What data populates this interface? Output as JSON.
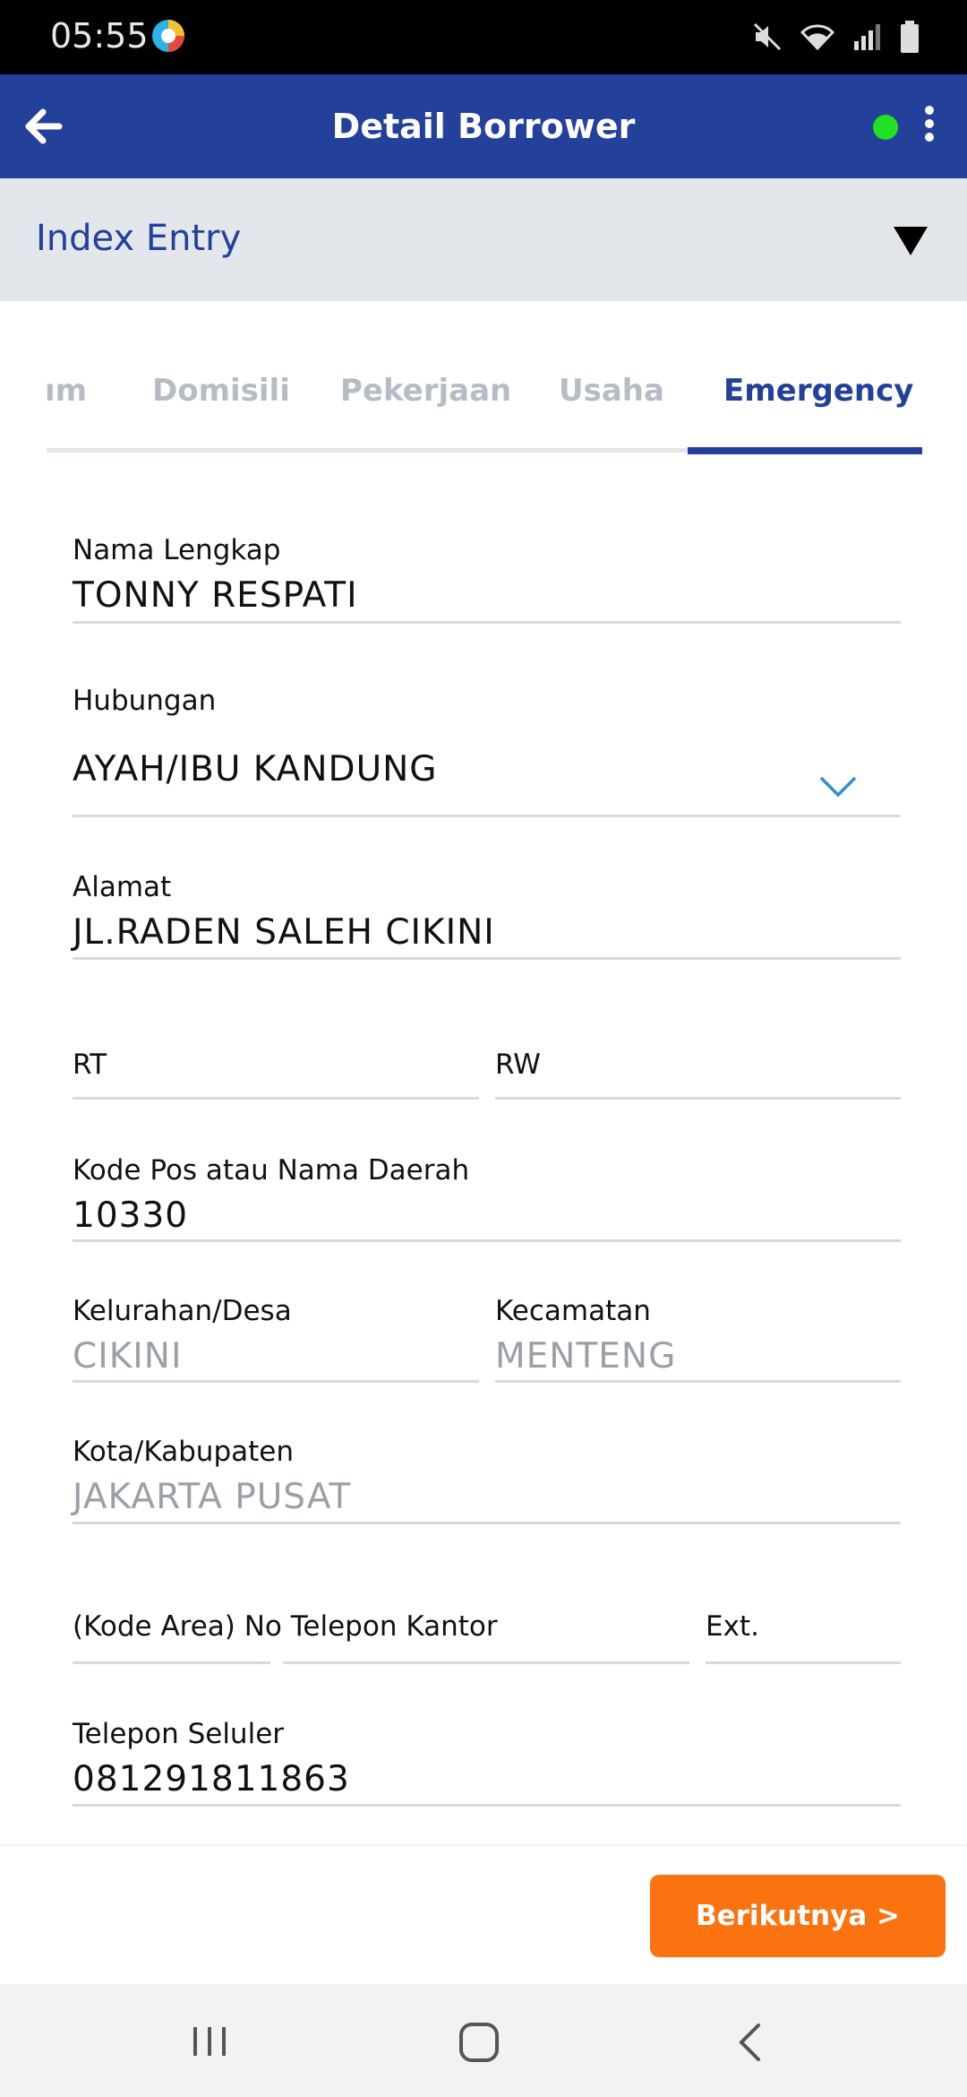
{
  "status_bar": {
    "time": "05:55",
    "icons": [
      "app-icon",
      "mute-icon",
      "wifi-icon",
      "signal-icon",
      "battery-icon"
    ]
  },
  "app_bar": {
    "title": "Detail Borrower",
    "back_icon": "arrow-left-icon",
    "status_dot_color": "#22e022",
    "menu_icon": "more-vertical-icon"
  },
  "index_entry": {
    "label": "Index Entry",
    "caret_icon": "triangle-down-icon"
  },
  "tabs": [
    {
      "label": "ım",
      "active": false
    },
    {
      "label": "Domisili",
      "active": false
    },
    {
      "label": "Pekerjaan",
      "active": false
    },
    {
      "label": "Usaha",
      "active": false
    },
    {
      "label": "Emergency",
      "active": true
    }
  ],
  "form": {
    "nama_lengkap": {
      "label": "Nama Lengkap",
      "value": "TONNY RESPATI"
    },
    "hubungan": {
      "label": "Hubungan",
      "value": "AYAH/IBU KANDUNG",
      "icon": "chevron-down-icon"
    },
    "alamat": {
      "label": "Alamat",
      "value": "JL.RADEN SALEH CIKINI"
    },
    "rt": {
      "label": "RT",
      "value": ""
    },
    "rw": {
      "label": "RW",
      "value": ""
    },
    "kode_pos": {
      "label": "Kode Pos atau Nama Daerah",
      "value": "10330"
    },
    "kelurahan": {
      "label": "Kelurahan/Desa",
      "value": "CIKINI"
    },
    "kecamatan": {
      "label": "Kecamatan",
      "value": "MENTENG"
    },
    "kota": {
      "label": "Kota/Kabupaten",
      "value": "JAKARTA PUSAT"
    },
    "telepon_kantor": {
      "label": "(Kode Area) No Telepon Kantor",
      "value": ""
    },
    "ext": {
      "label": "Ext.",
      "value": ""
    },
    "telepon_seluler": {
      "label": "Telepon Seluler",
      "value": "081291811863"
    }
  },
  "footer": {
    "next_label": "Berikutnya >"
  },
  "colors": {
    "primary": "#23409a",
    "accent": "#fb7310",
    "muted_text": "#9aa0a6",
    "tab_inactive": "#b6bcc4"
  },
  "nav_bar": {
    "icons": [
      "recent-apps-icon",
      "home-icon",
      "back-icon"
    ]
  }
}
